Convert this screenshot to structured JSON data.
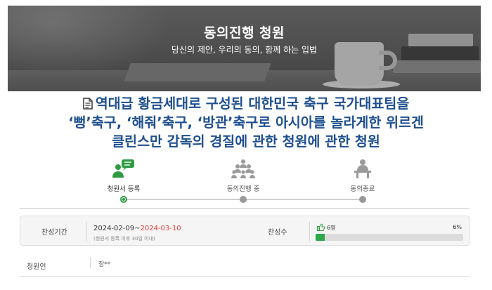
{
  "hero": {
    "title": "동의진행 청원",
    "subtitle": "당신의 제안, 우리의 동의, 함께 하는 입법"
  },
  "petition": {
    "title_lines": [
      "역대급 황금세대로 구성된 대한민국 축구 국가대표팀을",
      "‘뻥’축구, ‘해줘’축구, ‘방관’축구로 아시아를 놀라게한 위르겐",
      "클린스만 감독의 경질에 관한 청원에 관한 청원"
    ]
  },
  "steps": [
    {
      "label": "청원서 등록",
      "icon": "speech-person-icon",
      "active": true
    },
    {
      "label": "동의진행 중",
      "icon": "crowd-icon",
      "active": false
    },
    {
      "label": "동의종료",
      "icon": "podium-person-icon",
      "active": false
    }
  ],
  "info": {
    "period_label": "찬성기간",
    "period_start": "2024-02-09~",
    "period_end": "2024-03-10",
    "period_note": "(청원서 등록 이후 30일 이내)",
    "support_label": "찬성수",
    "support_count": "6명",
    "support_percent": "6%",
    "support_fraction": 0.06,
    "support_icon": "thumbs-up-icon"
  },
  "proposer": {
    "label": "청원인",
    "value": "장**"
  },
  "colors": {
    "title_blue": "#1e4f8f",
    "accent_green": "#2e9b43",
    "period_end_red": "#e23a2e"
  }
}
